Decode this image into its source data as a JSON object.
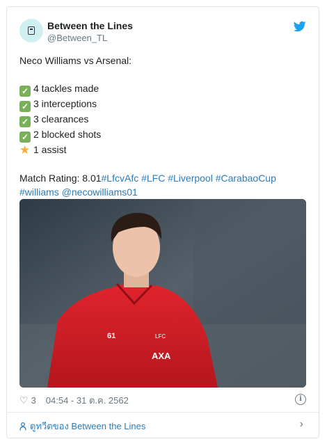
{
  "account": {
    "name": "Between the Lines",
    "handle": "@Between_TL"
  },
  "tweet": {
    "intro": "Neco Williams vs Arsenal:",
    "stats": [
      {
        "icon": "check-emoji",
        "text": "4 tackles made"
      },
      {
        "icon": "check-emoji",
        "text": "3 interceptions"
      },
      {
        "icon": "check-emoji",
        "text": "3 clearances"
      },
      {
        "icon": "check-emoji",
        "text": "2 blocked shots"
      },
      {
        "icon": "star-emoji",
        "text": "1 assist"
      }
    ],
    "rating_prefix": "Match Rating: 8.01",
    "hashtags": "#LfcvAfc #LFC #Liverpool #CarabaoCup",
    "hashtags2": "#williams",
    "mention": "@necowilliams01"
  },
  "footer": {
    "likes": "3",
    "timestamp": "04:54 - 31 ต.ค. 2562",
    "view_more": "ดูทวีตของ Between the Lines"
  },
  "colors": {
    "link": "#2b7bb9",
    "check": "#78b159",
    "star": "#ffac33",
    "twitter": "#1da1f2"
  }
}
